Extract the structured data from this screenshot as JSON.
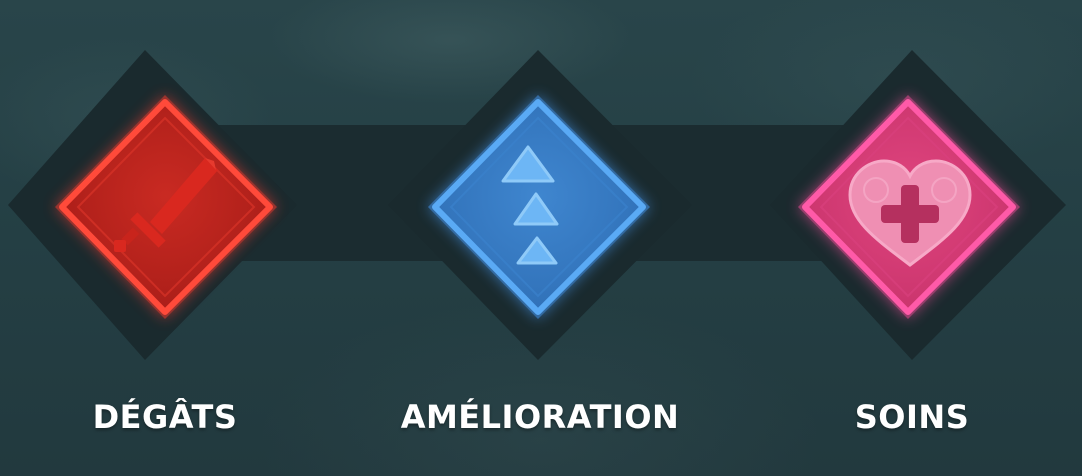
{
  "abilities": [
    {
      "label": "DÉGÂTS",
      "icon": "sword-icon",
      "color": "#e8332b"
    },
    {
      "label": "AMÉLIORATION",
      "icon": "stacked-arrows-icon",
      "color": "#4a9ae8"
    },
    {
      "label": "SOINS",
      "icon": "heart-plus-icon",
      "color": "#e8458f"
    }
  ]
}
